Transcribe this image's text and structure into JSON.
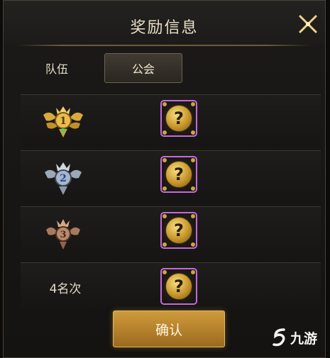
{
  "dialog": {
    "title": "奖励信息",
    "close_icon": "close-x-icon"
  },
  "tabs": [
    {
      "label": "队伍",
      "active": false
    },
    {
      "label": "公会",
      "active": true
    }
  ],
  "rows": [
    {
      "rank_icon": "rank-1-gold-trophy-icon",
      "reward": "?"
    },
    {
      "rank_icon": "rank-2-silver-trophy-icon",
      "reward": "?"
    },
    {
      "rank_icon": "rank-3-bronze-trophy-icon",
      "reward": "?"
    },
    {
      "rank_label": "4名次",
      "reward": "?"
    }
  ],
  "confirm_label": "确认",
  "watermark_text": "九游",
  "colors": {
    "accent_gold": "#cf9b3c",
    "reward_border": "#c56ad8",
    "text": "#e6ddc9"
  }
}
